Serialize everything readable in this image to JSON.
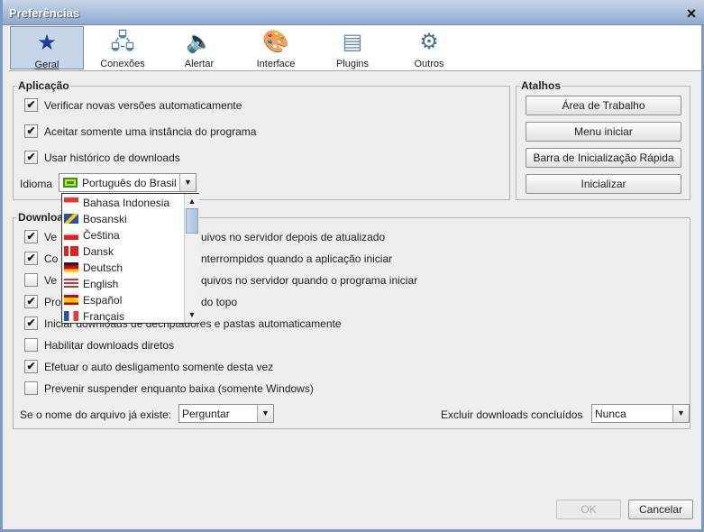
{
  "window": {
    "title": "Preferências",
    "close_icon": "×"
  },
  "tabs": [
    {
      "label": "Geral",
      "icon": "gear-star-icon"
    },
    {
      "label": "Conexões",
      "icon": "network-icon"
    },
    {
      "label": "Alertar",
      "icon": "speaker-icon"
    },
    {
      "label": "Interface",
      "icon": "palette-icon"
    },
    {
      "label": "Plugins",
      "icon": "plugin-icon"
    },
    {
      "label": "Outros",
      "icon": "tools-icon"
    }
  ],
  "aplicacao": {
    "title": "Aplicação",
    "options": [
      {
        "label": "Verificar novas versões automaticamente",
        "checked": true
      },
      {
        "label": "Aceitar somente uma instância do programa",
        "checked": true
      },
      {
        "label": "Usar histórico de downloads",
        "checked": true
      }
    ],
    "idioma_label": "Idioma",
    "idioma_value": "Português do Brasil",
    "languages": [
      "Bahasa Indonesia",
      "Bosanski",
      "Čeština",
      "Dansk",
      "Deutsch",
      "English",
      "Español",
      "Français"
    ]
  },
  "atalhos": {
    "title": "Atalhos",
    "buttons": [
      "Área de Trabalho",
      "Menu iniciar",
      "Barra de Inicialização Rápida",
      "Inicializar"
    ]
  },
  "downloads": {
    "title": "Downloa",
    "options": [
      {
        "a": "Ve",
        "b": "uivos no servidor depois de atualizado",
        "checked": true
      },
      {
        "a": "Co",
        "b": "nterrompidos quando a aplicação iniciar",
        "checked": true
      },
      {
        "a": "Ve",
        "b": "quivos no servidor quando o programa iniciar",
        "checked": false
      },
      {
        "a": "Pro",
        "b": "do topo",
        "checked": true
      },
      {
        "a": "Iniciar downloads de decriptadores e pastas automaticamente",
        "b": "",
        "checked": true
      },
      {
        "a": "Habilitar downloads diretos",
        "b": "",
        "checked": false
      },
      {
        "a": "Efetuar o auto desligamento somente desta vez",
        "b": "",
        "checked": true
      },
      {
        "a": "Prevenir suspender enquanto baixa (somente Windows)",
        "b": "",
        "checked": false
      }
    ],
    "exists_label": "Se o nome do arquivo já existe:",
    "exists_value": "Perguntar",
    "delete_label": "Excluir downloads concluídos",
    "delete_value": "Nunca"
  },
  "footer": {
    "ok": "OK",
    "cancel": "Cancelar"
  }
}
